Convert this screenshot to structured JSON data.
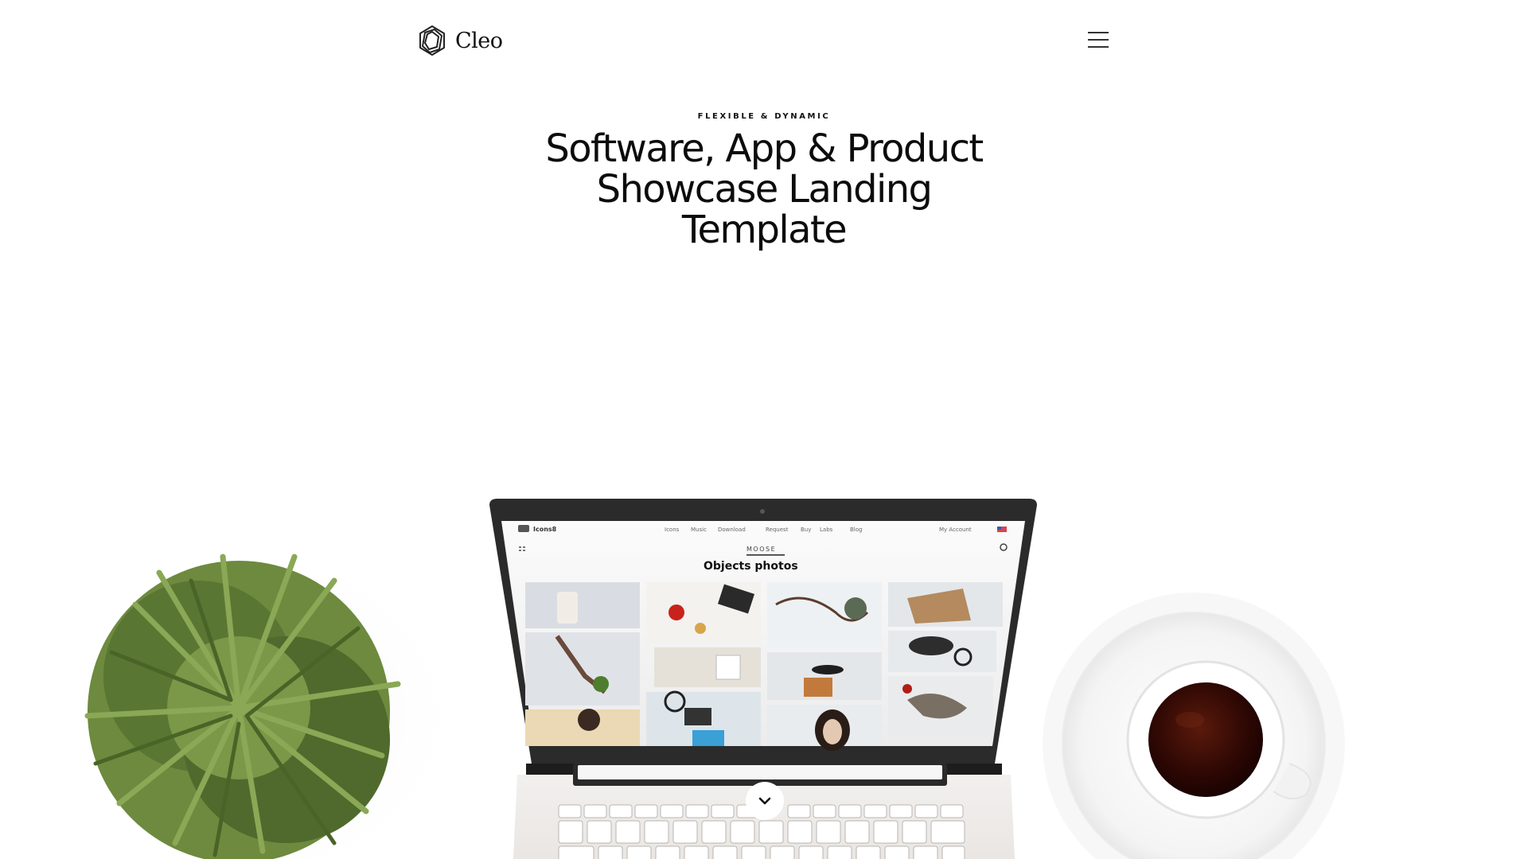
{
  "brand": {
    "name": "Cleo",
    "logo_icon": "cleo-logo-icon"
  },
  "nav": {
    "menu_icon": "hamburger-menu-icon"
  },
  "hero": {
    "eyebrow": "FLEXIBLE & DYNAMIC",
    "title_lines": [
      "Software, App & Product",
      "Showcase Landing",
      "Template"
    ]
  },
  "screen": {
    "site_name": "Icons8",
    "nav_items": [
      "Icons",
      "Music",
      "Download",
      "Request",
      "Buy",
      "Labs",
      "Blog"
    ],
    "account": "My Account",
    "tab": "MOOSE",
    "heading": "Objects photos"
  },
  "scroll": {
    "icon": "chevron-down-icon"
  },
  "colors": {
    "text": "#111111",
    "plant": "#5f7a35",
    "coffee": "#3a0c05",
    "laptop_frame": "#2b2b2b"
  }
}
